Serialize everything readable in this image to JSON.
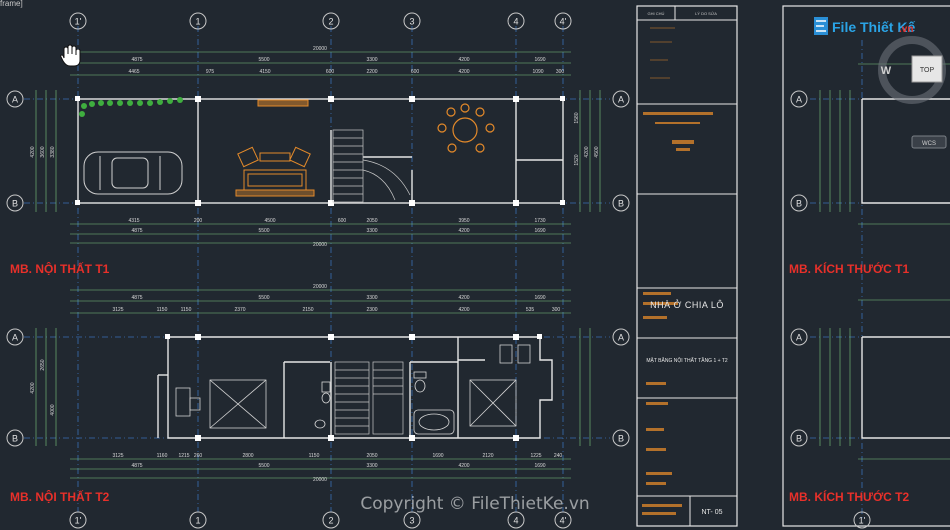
{
  "window": {
    "title_fragment": "frame]"
  },
  "plans": {
    "t1_interior": "MB. NỘI THẤT T1",
    "t2_interior": "MB. NỘI THẤT T2",
    "t1_dims": "MB. KÍCH THƯỚC T1",
    "t2_dims": "MB. KÍCH THƯỚC T2"
  },
  "grid_axes": {
    "columns": [
      "1'",
      "1",
      "2",
      "3",
      "4",
      "4'"
    ],
    "rows": [
      "A",
      "B"
    ]
  },
  "dims_t1": {
    "total": "20000",
    "top_row1": [
      "4875",
      "5500",
      "3300",
      "4200",
      "1690"
    ],
    "top_row2": [
      "4465",
      "975",
      "4150",
      "600",
      "2200",
      "600",
      "4200",
      "1090",
      "300"
    ],
    "bottom_row1": [
      "4315",
      "200",
      "4500",
      "600",
      "2050",
      "3950",
      "1730"
    ],
    "left": [
      "4200",
      "3600",
      "3380"
    ],
    "right": [
      "1580",
      "1520",
      "4200",
      "4500"
    ]
  },
  "dims_t2": {
    "total": "20000",
    "top_row1": [
      "4875",
      "5500",
      "3300",
      "4200",
      "1690"
    ],
    "top_row2": [
      "3125",
      "1150",
      "1150",
      "2370",
      "2150",
      "2300",
      "4200",
      "535",
      "300"
    ],
    "bottom_row1": [
      "3125",
      "1160",
      "1215",
      "260",
      "2800",
      "1150",
      "2050",
      "1690",
      "2120",
      "1225",
      "240"
    ],
    "left": [
      "4200",
      "2650",
      "4000"
    ]
  },
  "title_block": {
    "header": [
      "GHI CHÚ",
      "LÝ DO SỬA"
    ],
    "project": "NHÀ Ở CHIA LÔ",
    "drawing_name": "MẶT BẰNG NỘI THẤT TẦNG 1 + T2",
    "sheet_no": "NT- 05"
  },
  "view_cube": {
    "face": "TOP",
    "compass": "W",
    "mode": "WCS"
  },
  "watermark": {
    "logo_text": "File Thiết Kế",
    "logo_suffix": ".vn",
    "copyright": "Copyright © FileThietKe.vn"
  },
  "colors": {
    "background": "#212830",
    "wall": "#e6e6e6",
    "dimension": "#7ec87e",
    "furniture": "#e48a2a",
    "grid_axis": "#3a6fb5",
    "grid_bubble": "#c8c8c8",
    "title_red": "#e8302a"
  }
}
